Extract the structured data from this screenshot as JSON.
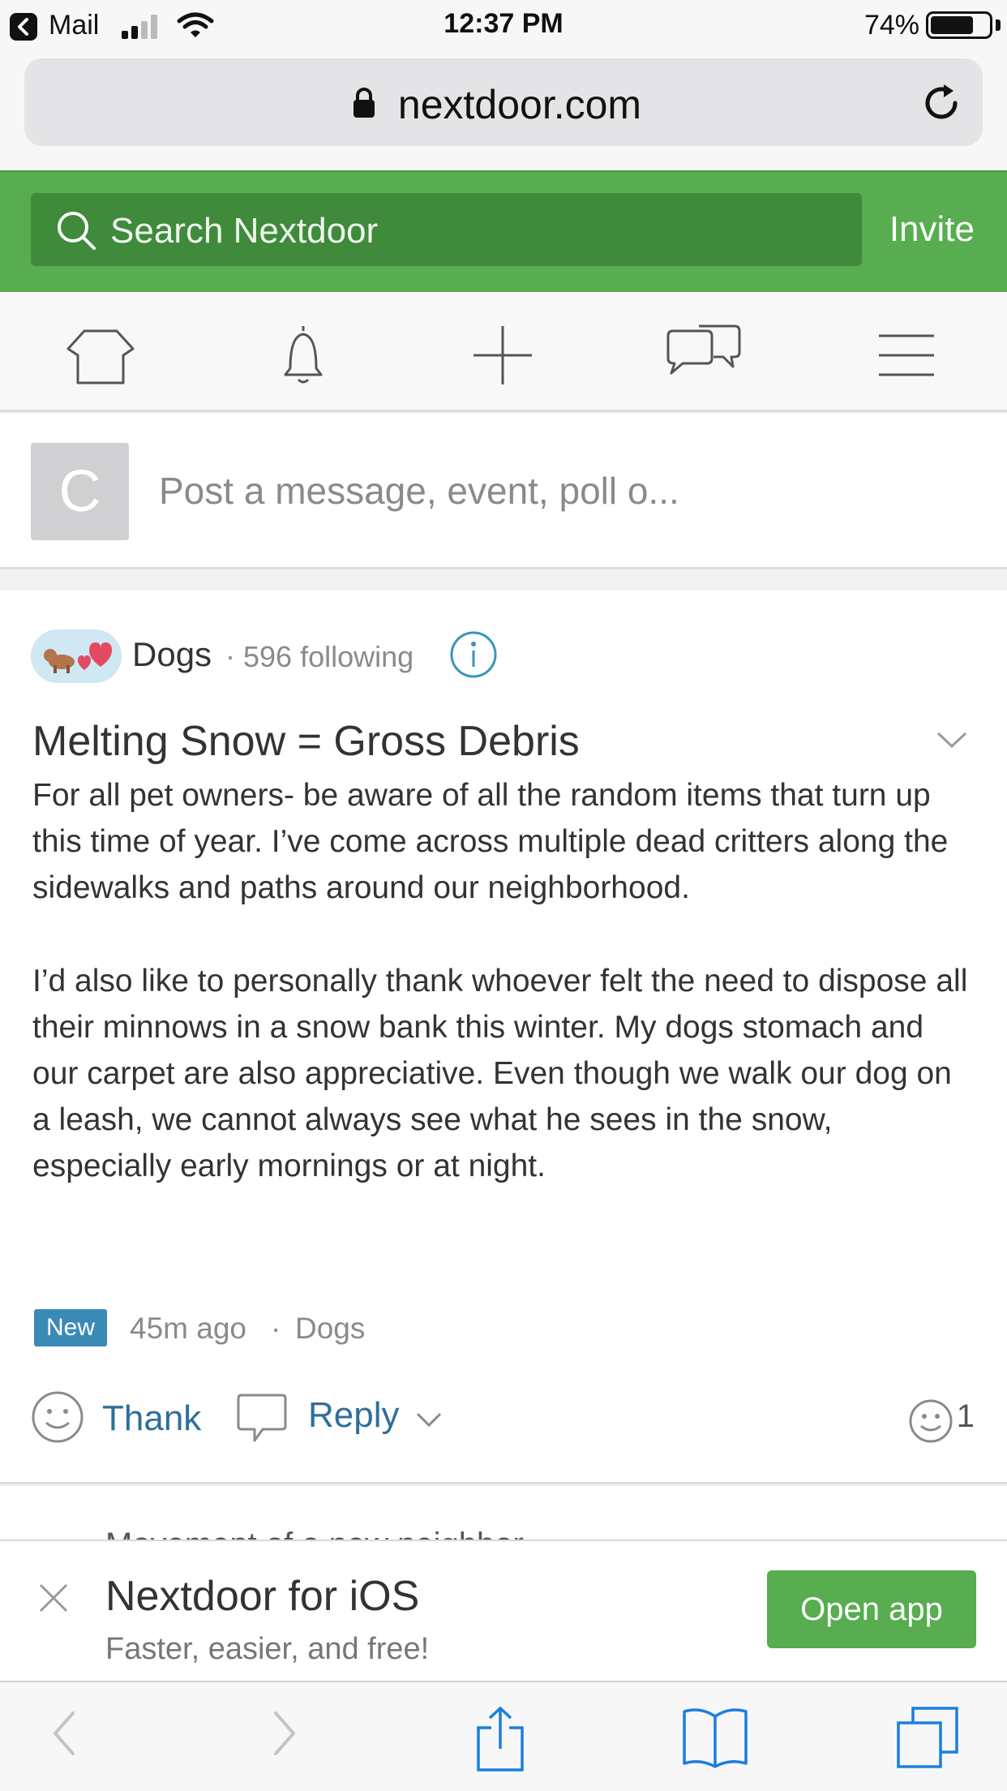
{
  "status_bar": {
    "back_app": "Mail",
    "time": "12:37 PM",
    "battery": "74%",
    "battery_level": 0.74
  },
  "browser": {
    "url": "nextdoor.com"
  },
  "header": {
    "search_placeholder": "Search Nextdoor",
    "invite_label": "Invite",
    "brand_color": "#57ad4f"
  },
  "nav": {
    "items": [
      {
        "icon": "home-icon"
      },
      {
        "icon": "bell-icon"
      },
      {
        "icon": "plus-icon"
      },
      {
        "icon": "chat-icon"
      },
      {
        "icon": "menu-icon"
      }
    ]
  },
  "composer": {
    "avatar_letter": "C",
    "placeholder": "Post a message, event, poll o..."
  },
  "post": {
    "group_name": "Dogs",
    "group_separator": "·",
    "group_following": "596 following",
    "title": "Melting Snow = Gross Debris",
    "body": [
      "For all pet owners- be aware of all the random items that turn up this time of year. I’ve come across multiple dead critters along the sidewalks and paths around our neighborhood.",
      "I’d also like to personally thank whoever felt the need to dispose all their minnows in a snow bank this winter. My dogs stomach and our carpet are also appreciative. Even though we walk our dog on a leash, we cannot always see what he sees in the snow, especially early mornings or at night."
    ],
    "badge": "New",
    "time_ago": "45m ago",
    "meta_separator": "·",
    "meta_group": "Dogs",
    "thank_label": "Thank",
    "reply_label": "Reply",
    "reaction_count": "1",
    "link_color": "#2f6f9a"
  },
  "next_post": {
    "peek_text": "Movement of a new neighbor..."
  },
  "app_banner": {
    "title": "Nextdoor for iOS",
    "subtitle": "Faster, easier, and free!",
    "open_label": "Open app"
  },
  "toolbar": {
    "items": [
      "back-icon",
      "forward-icon",
      "share-icon",
      "bookmarks-icon",
      "tabs-icon"
    ]
  }
}
